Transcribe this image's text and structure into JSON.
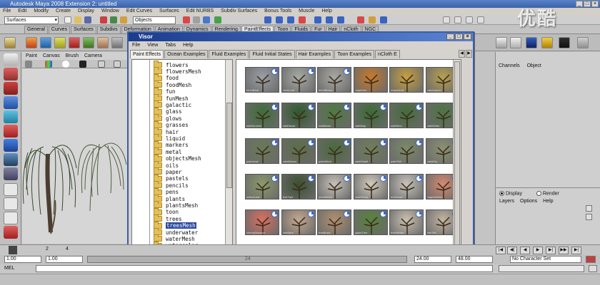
{
  "window": {
    "title": "Autodesk Maya 2008 Extension 2: untitled"
  },
  "menubar": [
    "File",
    "Edit",
    "Modify",
    "Create",
    "Display",
    "Window",
    "Edit Curves",
    "Surfaces",
    "Edit NURBS",
    "Subdiv Surfaces",
    "Bonus Tools",
    "Muscle",
    "Help"
  ],
  "status_line": {
    "mode": "Surfaces",
    "objects_field": "Objects"
  },
  "shelf_tabs": [
    "General",
    "Curves",
    "Surfaces",
    "Subdivs",
    "Deformation",
    "Animation",
    "Dynamics",
    "Rendering",
    "PaintEffects",
    "Toon",
    "Fluids",
    "Fur",
    "Hair",
    "nCloth",
    "NGC"
  ],
  "shelf_active": "PaintEffects",
  "viewport_menu": [
    "Paint",
    "Canvas",
    "Brush",
    "Camera"
  ],
  "visor": {
    "title": "Visor",
    "menu": [
      "File",
      "View",
      "Tabs",
      "Help"
    ],
    "tabs": [
      "Paint Effects",
      "Ocean Examples",
      "Fluid Examples",
      "Fluid Initial States",
      "Hair Examples",
      "Toon Examples",
      "nCloth E"
    ],
    "active_tab": "Paint Effects",
    "folders": [
      "flowers",
      "flowersMesh",
      "food",
      "foodMesh",
      "fun",
      "funMesh",
      "galactic",
      "glass",
      "glows",
      "grasses",
      "hair",
      "liquid",
      "markers",
      "metal",
      "objectsMesh",
      "oils",
      "paper",
      "pastels",
      "pencils",
      "pens",
      "plants",
      "plantsMesh",
      "toon",
      "trees",
      "treesMesh",
      "underwater",
      "waterMesh",
      "watercolor"
    ],
    "selected_folder": "treesMesh",
    "thumbnails": [
      {
        "caption": "birchBare",
        "color": "#9aa0a6",
        "badge": true
      },
      {
        "caption": "birchLeaf",
        "color": "#a7aba6",
        "badge": true
      },
      {
        "caption": "birchBlown",
        "color": "#a9a9a3",
        "badge": true
      },
      {
        "caption": "mapleAut",
        "color": "#c87a2a",
        "badge": false
      },
      {
        "caption": "mapleAutL",
        "color": "#c8a040",
        "badge": false
      },
      {
        "caption": "oakAutumn",
        "color": "#b8a050",
        "badge": false
      },
      {
        "caption": "oakSummer",
        "color": "#3e6e38",
        "badge": true
      },
      {
        "caption": "oakDense",
        "color": "#2e5a2a",
        "badge": true
      },
      {
        "caption": "oakBlown",
        "color": "#4e7a40",
        "badge": true
      },
      {
        "caption": "oakWarp",
        "color": "#3a6a34",
        "badge": true
      },
      {
        "caption": "oakWind",
        "color": "#446c3a",
        "badge": true
      },
      {
        "caption": "oakWinter",
        "color": "#4e7444",
        "badge": true
      },
      {
        "caption": "palmLeaf",
        "color": "#6a7a58",
        "badge": true
      },
      {
        "caption": "palmBlown",
        "color": "#5a6e48",
        "badge": true
      },
      {
        "caption": "palmWind",
        "color": "#4a6a3a",
        "badge": true
      },
      {
        "caption": "palmSmall",
        "color": "#6e7e5a",
        "badge": true
      },
      {
        "caption": "palmTall",
        "color": "#7a8a68",
        "badge": true
      },
      {
        "caption": "palmDry",
        "color": "#8a9272",
        "badge": true
      },
      {
        "caption": "willowLeaf",
        "color": "#8a9a6a",
        "badge": true
      },
      {
        "caption": "fernTree",
        "color": "#3a5030",
        "badge": true
      },
      {
        "caption": "pineWinter",
        "color": "#c6c2b8",
        "badge": true
      },
      {
        "caption": "pineWindy",
        "color": "#d2cbbd",
        "badge": true
      },
      {
        "caption": "treeDead",
        "color": "#c8c4bc",
        "badge": true
      },
      {
        "caption": "mapleWinter",
        "color": "#d48a70",
        "badge": true
      },
      {
        "caption": "cherryBlossom",
        "color": "#d87060",
        "badge": true
      },
      {
        "caption": "treeBare",
        "color": "#c4a890",
        "badge": true
      },
      {
        "caption": "treeBurnt",
        "color": "#b09070",
        "badge": true
      },
      {
        "caption": "grassTree",
        "color": "#58823e",
        "badge": true
      },
      {
        "caption": "treeWinter",
        "color": "#c9c0b0",
        "badge": true
      },
      {
        "caption": "treeTall",
        "color": "#c2b4a2",
        "badge": true
      }
    ]
  },
  "channel_box": {
    "menu": [
      "Channels",
      "Object"
    ]
  },
  "layer_editor": {
    "display_label": "Display",
    "render_label": "Render",
    "menu": [
      "Layers",
      "Options",
      "Help"
    ]
  },
  "timeline": {
    "ticks": [
      "2",
      "4"
    ]
  },
  "range": {
    "start": "1.00",
    "start2": "1.00",
    "end": "24.00",
    "end2": "48.00",
    "character_set": "No Character Set",
    "frame_label": "24"
  },
  "command_line": {
    "label": "MEL"
  },
  "watermark": "优酷"
}
